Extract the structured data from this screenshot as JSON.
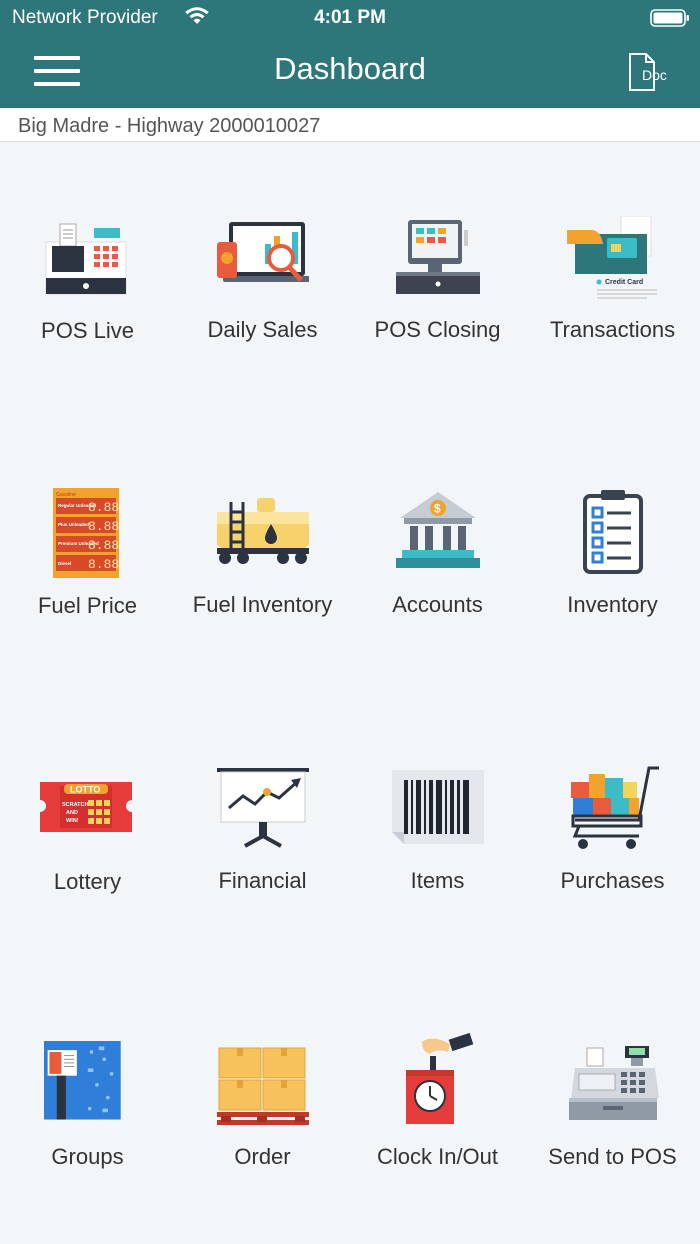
{
  "status_bar": {
    "carrier": "Network Provider",
    "time": "4:01 PM"
  },
  "header": {
    "title": "Dashboard",
    "doc_button": "Doc"
  },
  "store": {
    "name": "Big Madre - Highway 2000010027"
  },
  "tiles": [
    {
      "label": "POS Live",
      "icon": "cash-register-icon"
    },
    {
      "label": "Daily Sales",
      "icon": "sales-analytics-icon"
    },
    {
      "label": "POS Closing",
      "icon": "pos-terminal-icon"
    },
    {
      "label": "Transactions",
      "icon": "credit-card-icon"
    },
    {
      "label": "Fuel Price",
      "icon": "fuel-price-board-icon"
    },
    {
      "label": "Fuel Inventory",
      "icon": "fuel-tank-car-icon"
    },
    {
      "label": "Accounts",
      "icon": "bank-icon"
    },
    {
      "label": "Inventory",
      "icon": "clipboard-checklist-icon"
    },
    {
      "label": "Lottery",
      "icon": "lottery-ticket-icon"
    },
    {
      "label": "Financial",
      "icon": "presentation-chart-icon"
    },
    {
      "label": "Items",
      "icon": "barcode-icon"
    },
    {
      "label": "Purchases",
      "icon": "shopping-cart-icon"
    },
    {
      "label": "Groups",
      "icon": "groups-book-icon"
    },
    {
      "label": "Order",
      "icon": "boxes-pallet-icon"
    },
    {
      "label": "Clock In/Out",
      "icon": "time-clock-icon"
    },
    {
      "label": "Send to POS",
      "icon": "register-machine-icon"
    }
  ],
  "fuel_board": {
    "title": "Gasoline",
    "grades": [
      "Regular Unleaded",
      "Plus Unleaded",
      "Premium Unleaded",
      "Diesel"
    ],
    "price": "8.88"
  },
  "lottery_ticket": {
    "brand": "LOTTO",
    "line1": "SCRATCH",
    "line2": "AND",
    "line3": "WIN!"
  },
  "credit_card_text": "Credit Card",
  "bank_symbol": "$",
  "colors": {
    "header": "#2d7679",
    "background": "#f2f6f9",
    "label": "#333333"
  }
}
